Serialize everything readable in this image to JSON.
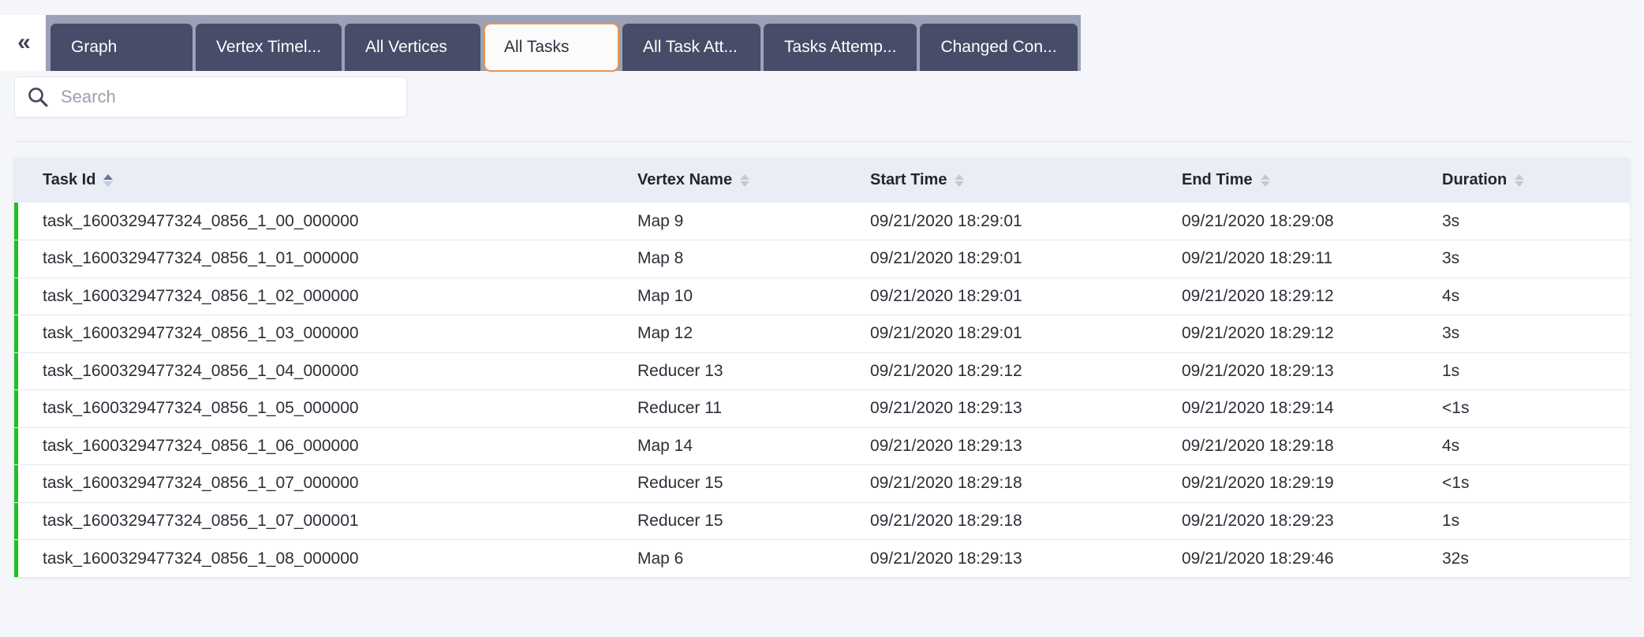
{
  "tabbar": {
    "collapse_glyph": "«",
    "tabs": [
      {
        "label": "Graph",
        "active": false
      },
      {
        "label": "Vertex Timel...",
        "active": false
      },
      {
        "label": "All Vertices",
        "active": false
      },
      {
        "label": "All Tasks",
        "active": true
      },
      {
        "label": "All Task Att...",
        "active": false
      },
      {
        "label": "Tasks Attemp...",
        "active": false
      },
      {
        "label": "Changed Con...",
        "active": false
      }
    ],
    "active_border_color": "#e8964d",
    "tab_bg": "#474c68",
    "band_bg": "#9ba1b6"
  },
  "search": {
    "placeholder": "Search",
    "value": ""
  },
  "table": {
    "columns": [
      {
        "label": "Task Id",
        "sort": "asc"
      },
      {
        "label": "Vertex Name",
        "sort": "none"
      },
      {
        "label": "Start Time",
        "sort": "none"
      },
      {
        "label": "End Time",
        "sort": "none"
      },
      {
        "label": "Duration",
        "sort": "none"
      }
    ],
    "status_color": "#1fc11f",
    "rows": [
      {
        "task_id": "task_1600329477324_0856_1_00_000000",
        "vertex_name": "Map 9",
        "start_time": "09/21/2020 18:29:01",
        "end_time": "09/21/2020 18:29:08",
        "duration": "3s"
      },
      {
        "task_id": "task_1600329477324_0856_1_01_000000",
        "vertex_name": "Map 8",
        "start_time": "09/21/2020 18:29:01",
        "end_time": "09/21/2020 18:29:11",
        "duration": "3s"
      },
      {
        "task_id": "task_1600329477324_0856_1_02_000000",
        "vertex_name": "Map 10",
        "start_time": "09/21/2020 18:29:01",
        "end_time": "09/21/2020 18:29:12",
        "duration": "4s"
      },
      {
        "task_id": "task_1600329477324_0856_1_03_000000",
        "vertex_name": "Map 12",
        "start_time": "09/21/2020 18:29:01",
        "end_time": "09/21/2020 18:29:12",
        "duration": "3s"
      },
      {
        "task_id": "task_1600329477324_0856_1_04_000000",
        "vertex_name": "Reducer 13",
        "start_time": "09/21/2020 18:29:12",
        "end_time": "09/21/2020 18:29:13",
        "duration": "1s"
      },
      {
        "task_id": "task_1600329477324_0856_1_05_000000",
        "vertex_name": "Reducer 11",
        "start_time": "09/21/2020 18:29:13",
        "end_time": "09/21/2020 18:29:14",
        "duration": "<1s"
      },
      {
        "task_id": "task_1600329477324_0856_1_06_000000",
        "vertex_name": "Map 14",
        "start_time": "09/21/2020 18:29:13",
        "end_time": "09/21/2020 18:29:18",
        "duration": "4s"
      },
      {
        "task_id": "task_1600329477324_0856_1_07_000000",
        "vertex_name": "Reducer 15",
        "start_time": "09/21/2020 18:29:18",
        "end_time": "09/21/2020 18:29:19",
        "duration": "<1s"
      },
      {
        "task_id": "task_1600329477324_0856_1_07_000001",
        "vertex_name": "Reducer 15",
        "start_time": "09/21/2020 18:29:18",
        "end_time": "09/21/2020 18:29:23",
        "duration": "1s"
      },
      {
        "task_id": "task_1600329477324_0856_1_08_000000",
        "vertex_name": "Map 6",
        "start_time": "09/21/2020 18:29:13",
        "end_time": "09/21/2020 18:29:46",
        "duration": "32s"
      }
    ]
  }
}
